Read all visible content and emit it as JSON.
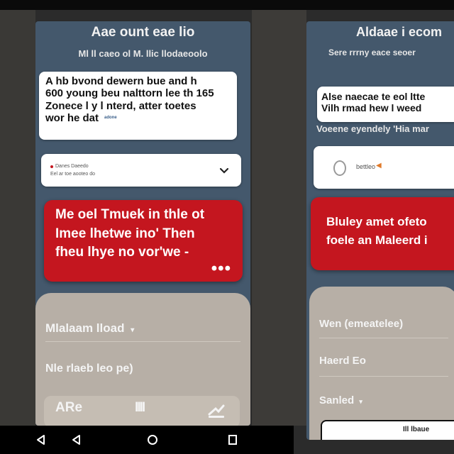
{
  "left": {
    "title": "Aae ount eae lio",
    "subtitle": "Ml ll caeo ol M. llic llodaeoolo",
    "message_card": {
      "lines": [
        "A hb bvond dewern bue and h",
        "600 young beu nalttorn lee th 165",
        "Zonece l y l nterd, atter toetes",
        "wor he dat"
      ],
      "small_tag": "adone"
    },
    "contact_card": {
      "line1": "Danes Daeedo",
      "line2": "Eel ar toe aooteo do"
    },
    "alert": {
      "lines": [
        "Me oel Tmuek in thle ot",
        "Imee lhetwe ino' Then",
        "fheu lhye no vor'we -"
      ],
      "dots": "•••"
    },
    "menu": {
      "item1": "Mlalaam lload",
      "item2": "Nle rlaeb leo pe)"
    },
    "toolbar": {
      "left_label": "ARe",
      "mid_label": "IIII"
    }
  },
  "right": {
    "title": "Aldaae i ecom",
    "subtitle": "Sere rrrny eace seoer",
    "message_card": {
      "lines": [
        "Alse naecae te eol ltte",
        "Vilh rmad hew l weed"
      ]
    },
    "caption": "Voeene eyendely 'Hia mar",
    "contact_card": {
      "label": "bettleo"
    },
    "alert": {
      "lines": [
        "Bluley amet ofeto",
        "foele an Maleerd i"
      ]
    },
    "menu": {
      "item1": "Wen (emeatelee)",
      "item2": "Haerd Eo",
      "item3": "Sanled"
    },
    "bottom_button": "Ill lbaue"
  },
  "colors": {
    "screen": "#44586c",
    "alert": "#c4161f",
    "sheet": "#b7afa6",
    "card": "#ffffff"
  }
}
